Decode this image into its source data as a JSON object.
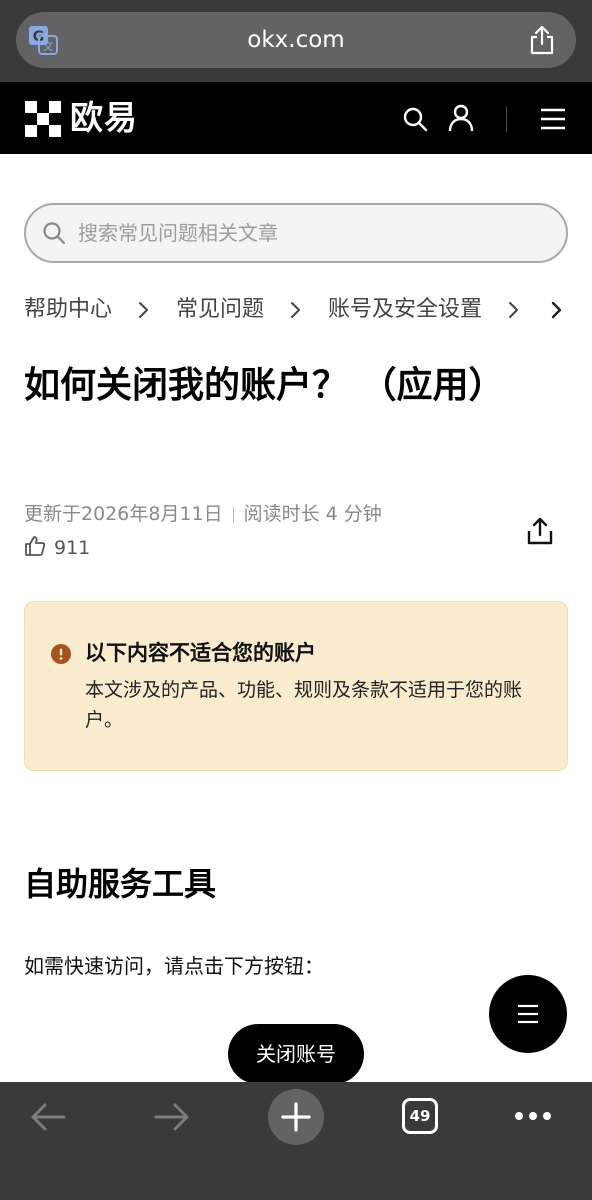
{
  "browser": {
    "url": "okx.com",
    "tab_count": "49"
  },
  "site": {
    "logo_text": "欧易"
  },
  "search": {
    "placeholder": "搜索常见问题相关文章"
  },
  "breadcrumb": {
    "items": [
      "帮助中心",
      "常见问题",
      "账号及安全设置"
    ]
  },
  "article": {
    "title": "如何关闭我的账户？ （应用）",
    "updated": "更新于2026年8月11日",
    "read_time": "阅读时长 4 分钟",
    "likes": "911"
  },
  "notice": {
    "title": "以下内容不适合您的账户",
    "body": "本文涉及的产品、功能、规则及条款不适用于您的账户。"
  },
  "section": {
    "title": "自助服务工具",
    "text": "如需快速访问，请点击下方按钮："
  },
  "buttons": {
    "close_account": "关闭账号"
  },
  "colors": {
    "notice_bg": "#fbeccf",
    "notice_icon": "#a8521c",
    "header_bg": "#000000",
    "browser_chrome": "#3a3a3c"
  },
  "icons": [
    "translate-icon",
    "share-icon",
    "search-icon",
    "user-icon",
    "menu-icon",
    "chevron-right-icon",
    "thumbs-up-icon",
    "alert-icon",
    "back-arrow-icon",
    "forward-arrow-icon",
    "plus-icon",
    "tabs-icon",
    "more-icon"
  ]
}
